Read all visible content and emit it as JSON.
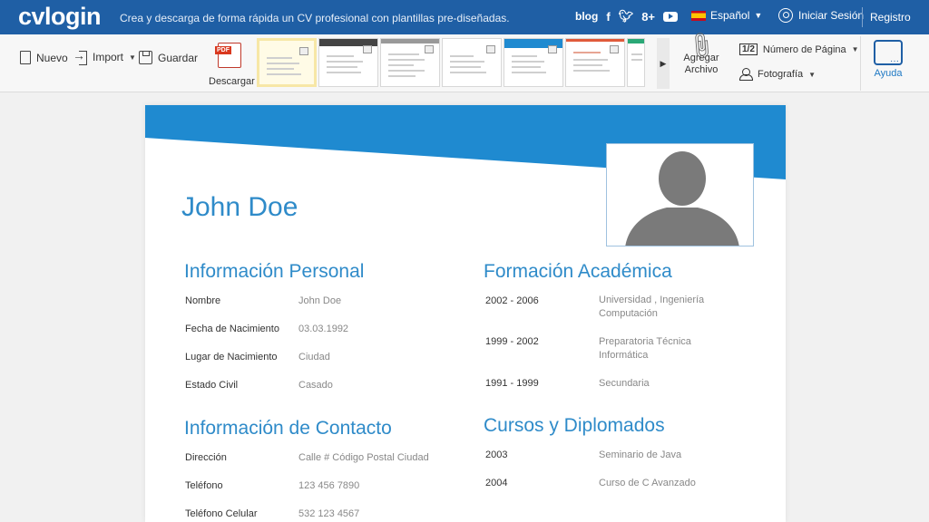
{
  "header": {
    "logo": "cvlogin",
    "tagline": "Crea y descarga de forma rápida un CV profesional con plantillas pre-diseñadas.",
    "blog": "blog",
    "social": {
      "facebook": "f",
      "twitter": "t",
      "googleplus": "8+"
    },
    "language": "Español",
    "login": "Iniciar Sesión",
    "register": "Registro"
  },
  "toolbar": {
    "new": "Nuevo",
    "import": "Import",
    "save": "Guardar",
    "download": "Descargar",
    "pdf": "PDF",
    "attach": "Agregar Archivo",
    "page_number_box": "1/2",
    "page_number": "Número de Página",
    "photo": "Fotografía",
    "help": "Ayuda"
  },
  "cv": {
    "name": "John Doe",
    "personal": {
      "title": "Información Personal",
      "rows": [
        {
          "label": "Nombre",
          "value": "John Doe"
        },
        {
          "label": "Fecha de Nacimiento",
          "value": "03.03.1992"
        },
        {
          "label": "Lugar de Nacimiento",
          "value": "Ciudad"
        },
        {
          "label": "Estado Civil",
          "value": "Casado"
        }
      ]
    },
    "contact": {
      "title": "Información de Contacto",
      "rows": [
        {
          "label": "Dirección",
          "value": "Calle # Código Postal Ciudad"
        },
        {
          "label": "Teléfono",
          "value": "123 456 7890"
        },
        {
          "label": "Teléfono Celular",
          "value": "532 123 4567"
        }
      ]
    },
    "education": {
      "title": "Formación Académica",
      "rows": [
        {
          "label": "2002 - 2006",
          "value": "Universidad , Ingeniería Computación"
        },
        {
          "label": "1999 - 2002",
          "value": "Preparatoria Técnica Informática"
        },
        {
          "label": "1991 - 1999",
          "value": "Secundaria"
        }
      ]
    },
    "courses": {
      "title": "Cursos y Diplomados",
      "rows": [
        {
          "label": "2003",
          "value": "Seminario de Java"
        },
        {
          "label": "2004",
          "value": "Curso de C Avanzado"
        }
      ]
    }
  },
  "colors": {
    "brand": "#1f5fa5",
    "cv_accent": "#1f8ad0",
    "title": "#2f8bc9"
  }
}
